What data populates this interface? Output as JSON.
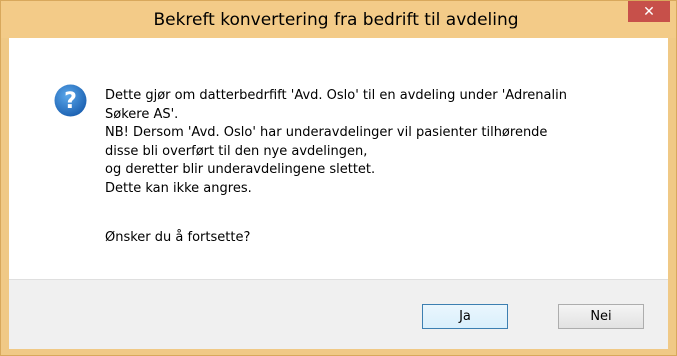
{
  "window": {
    "title": "Bekreft konvertering fra bedrift til avdeling",
    "close_label": "✕"
  },
  "dialog": {
    "icon": "question-icon",
    "message_lines": [
      "Dette gjør om datterbedrfift 'Avd. Oslo' til en avdeling under 'Adrenalin",
      "Søkere AS'.",
      "NB! Dersom 'Avd. Oslo' har underavdelinger vil pasienter tilhørende",
      "disse bli overført til den nye avdelingen,",
      "og deretter blir underavdelingene slettet.",
      "Dette kan ikke angres."
    ],
    "question": "Ønsker du å fortsette?"
  },
  "buttons": {
    "yes_label": "Ja",
    "no_label": "Nei"
  },
  "colors": {
    "titlebar": "#f3cb88",
    "close": "#c7504a",
    "icon": "#1f6fc2",
    "footer": "#f0f0f0"
  }
}
